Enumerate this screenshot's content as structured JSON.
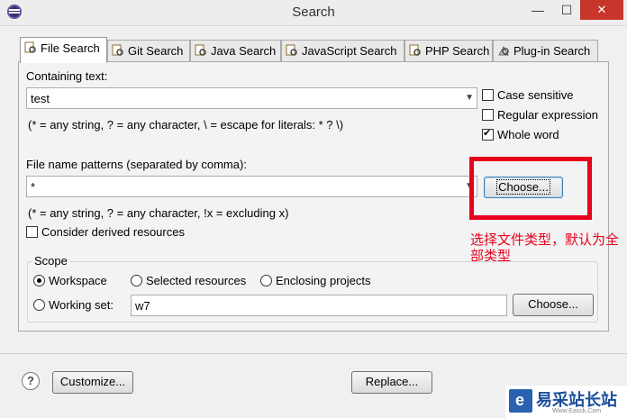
{
  "window": {
    "title": "Search",
    "minimize": "—",
    "maximize": "☐",
    "close": "✕"
  },
  "tabs": [
    {
      "label": "File Search",
      "active": true
    },
    {
      "label": "Git Search"
    },
    {
      "label": "Java Search"
    },
    {
      "label": "JavaScript Search"
    },
    {
      "label": "PHP Search"
    },
    {
      "label": "Plug-in Search"
    }
  ],
  "containing": {
    "label": "Containing text:",
    "value": "test",
    "hint": "(* = any string, ? = any character, \\ = escape for literals: * ? \\)"
  },
  "options": {
    "case_sensitive": "Case sensitive",
    "regex": "Regular expression",
    "whole_word": "Whole word"
  },
  "patterns": {
    "label": "File name patterns (separated by comma):",
    "value": "*",
    "hint": "(* = any string, ? = any character, !x = excluding x)",
    "choose": "Choose...",
    "derived": "Consider derived resources"
  },
  "scope": {
    "title": "Scope",
    "workspace": "Workspace",
    "selected": "Selected resources",
    "enclosing": "Enclosing projects",
    "working_set": "Working set:",
    "working_set_value": "w7",
    "choose": "Choose..."
  },
  "annotation": "选择文件类型，默认为全部类型",
  "footer": {
    "help": "?",
    "customize": "Customize...",
    "replace": "Replace..."
  },
  "watermark": {
    "name": "易采站长站",
    "sub": "Www.Easck.Com"
  }
}
